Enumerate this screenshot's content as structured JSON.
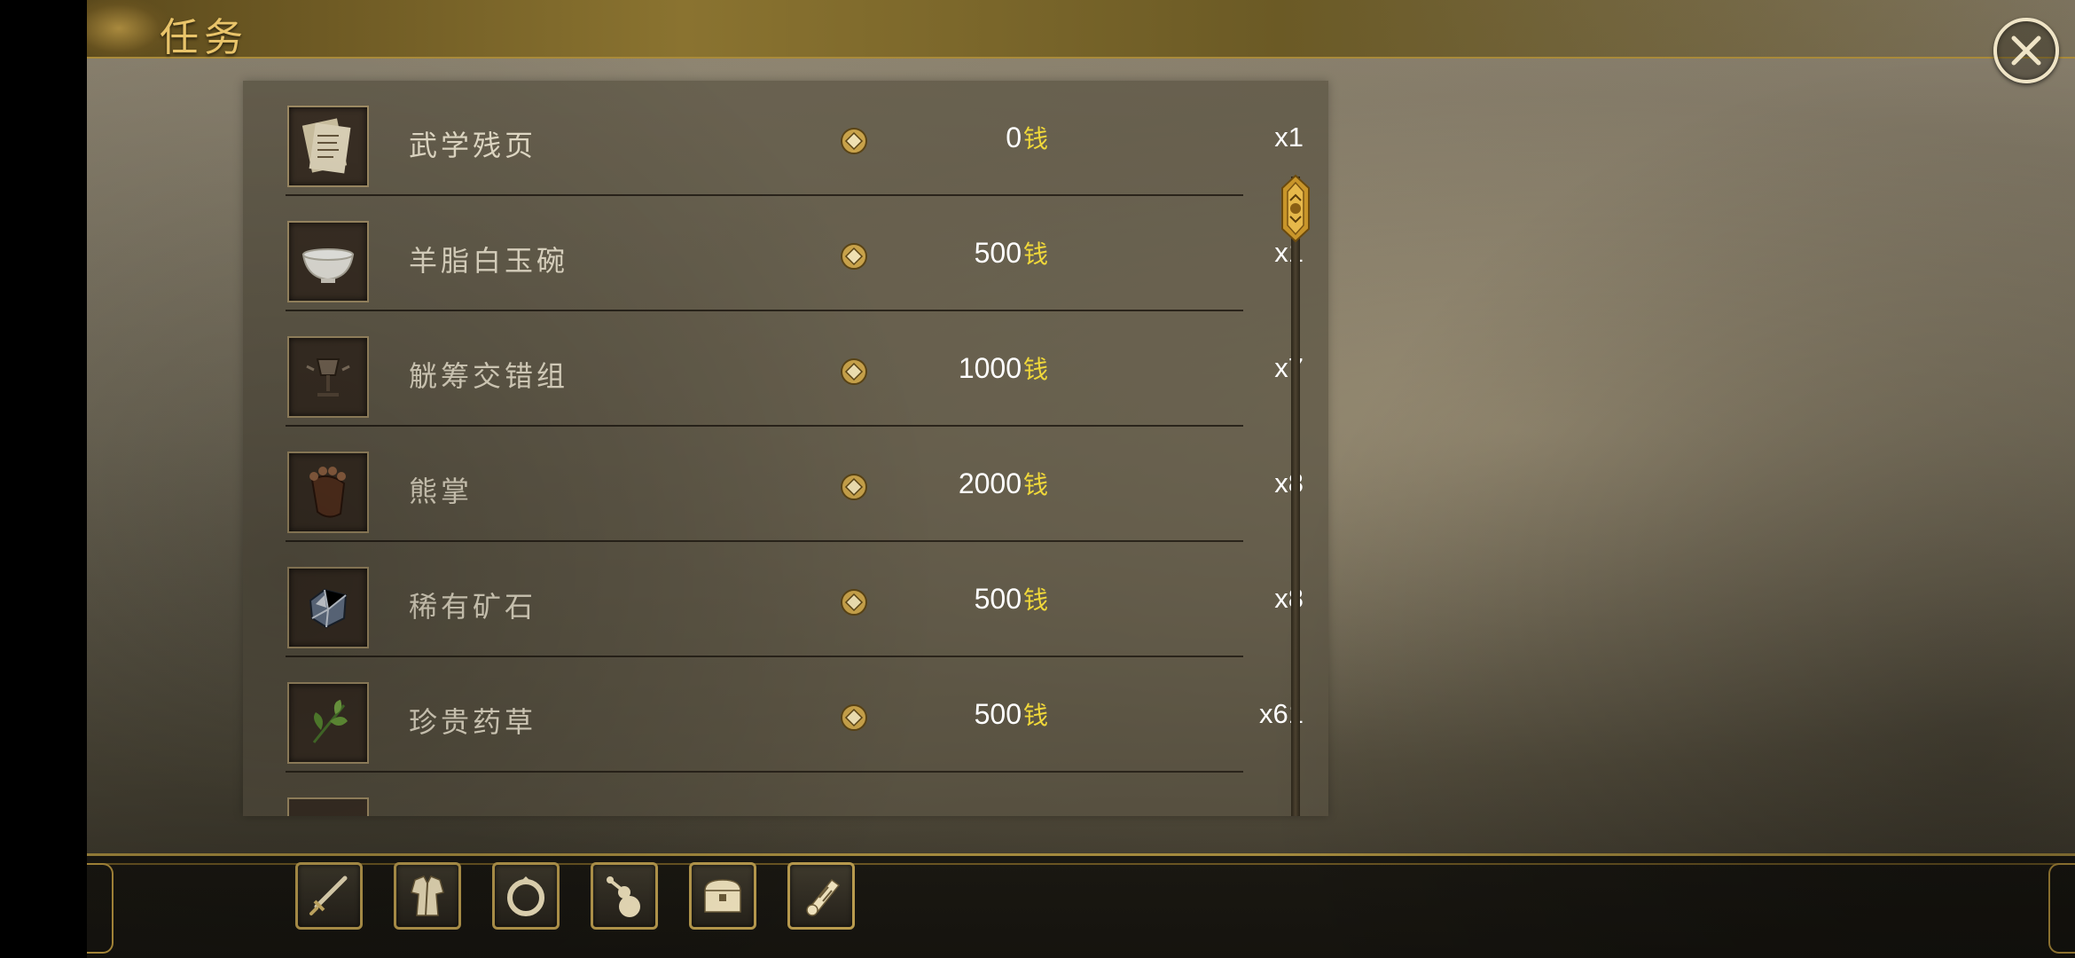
{
  "header": {
    "title": "任务"
  },
  "currency_unit": "钱",
  "items": [
    {
      "name": "武学残页",
      "price": "0",
      "qty": "x1",
      "icon": "scroll-pages-icon"
    },
    {
      "name": "羊脂白玉碗",
      "price": "500",
      "qty": "x1",
      "icon": "jade-bowl-icon"
    },
    {
      "name": "觥筹交错组",
      "price": "1000",
      "qty": "x7",
      "icon": "goblet-set-icon"
    },
    {
      "name": "熊掌",
      "price": "2000",
      "qty": "x8",
      "icon": "bear-paw-icon"
    },
    {
      "name": "稀有矿石",
      "price": "500",
      "qty": "x8",
      "icon": "ore-icon"
    },
    {
      "name": "珍贵药草",
      "price": "500",
      "qty": "x61",
      "icon": "herb-icon"
    }
  ],
  "toolbar": [
    {
      "name": "weapon-tab",
      "icon": "sword-icon"
    },
    {
      "name": "armor-tab",
      "icon": "robe-icon"
    },
    {
      "name": "accessory-tab",
      "icon": "ring-icon"
    },
    {
      "name": "consumable-tab",
      "icon": "gourd-icon"
    },
    {
      "name": "material-tab",
      "icon": "chest-icon"
    },
    {
      "name": "quest-tab",
      "icon": "scroll-icon"
    }
  ],
  "colors": {
    "title": "#e9c46a",
    "currency": "#f0d83a",
    "frame": "#b99b4e"
  }
}
